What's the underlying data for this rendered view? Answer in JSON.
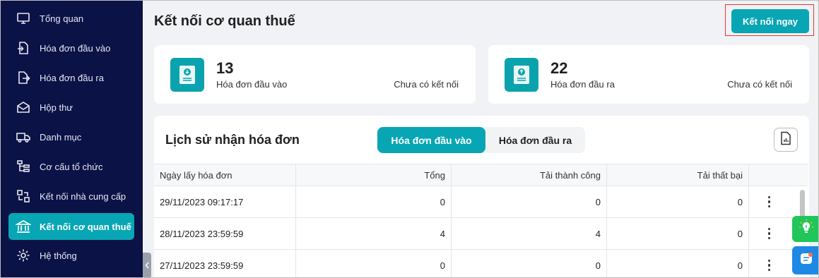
{
  "sidebar": {
    "items": [
      {
        "label": "Tổng quan",
        "icon": "monitor-icon"
      },
      {
        "label": "Hóa đơn đầu vào",
        "icon": "file-import-icon"
      },
      {
        "label": "Hóa đơn đầu ra",
        "icon": "file-export-icon"
      },
      {
        "label": "Hộp thư",
        "icon": "mail-icon"
      },
      {
        "label": "Danh mục",
        "icon": "truck-icon"
      },
      {
        "label": "Cơ cấu tổ chức",
        "icon": "org-structure-icon"
      },
      {
        "label": "Kết nối nhà cung cấp",
        "icon": "swap-icon"
      },
      {
        "label": "Kết nối cơ quan thuế",
        "icon": "bank-icon",
        "active": true
      },
      {
        "label": "Hệ thống",
        "icon": "gear-icon"
      }
    ]
  },
  "header": {
    "title": "Kết nối cơ quan thuế",
    "connect_button": "Kết nối ngay"
  },
  "stats": [
    {
      "count": "13",
      "label": "Hóa đơn đầu vào",
      "status": "Chưa có kết nối"
    },
    {
      "count": "22",
      "label": "Hóa đơn đầu ra",
      "status": "Chưa có kết nối"
    }
  ],
  "history": {
    "title": "Lịch sử nhận hóa đơn",
    "tabs": [
      {
        "label": "Hóa đơn đầu vào",
        "active": true
      },
      {
        "label": "Hóa đơn đầu ra",
        "active": false
      }
    ],
    "columns": [
      "Ngày lấy hóa đơn",
      "Tổng",
      "Tải thành công",
      "Tải thất bại"
    ],
    "rows": [
      {
        "date": "29/11/2023 09:17:17",
        "total": "0",
        "success": "0",
        "failed": "0"
      },
      {
        "date": "28/11/2023 23:59:59",
        "total": "4",
        "success": "4",
        "failed": "0"
      },
      {
        "date": "27/11/2023 23:59:59",
        "total": "0",
        "success": "0",
        "failed": "0"
      }
    ]
  },
  "colors": {
    "sidebar_bg": "#0b1246",
    "accent": "#08a6b4",
    "highlight": "#e53935"
  }
}
